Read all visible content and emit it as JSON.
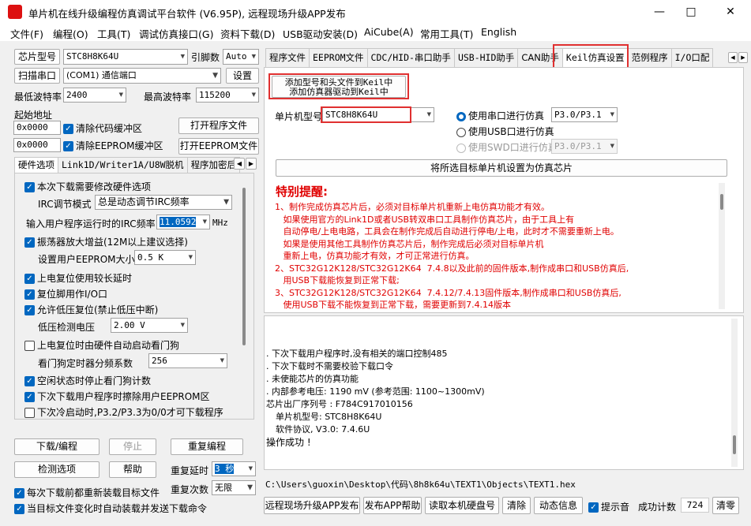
{
  "window": {
    "title": "单片机在线升级编程仿真调试平台软件 (V6.95P), 远程现场升级APP发布"
  },
  "menu": [
    "文件(F)",
    "编程(O)",
    "工具(T)",
    "调试仿真接口(G)",
    "资料下载(D)",
    "USB驱动安装(D)",
    "AiCube(A)",
    "常用工具(T)",
    "English"
  ],
  "left": {
    "chip_btn": "芯片型号",
    "chip_value": "STC8H8K64U",
    "pin_label": "引脚数",
    "pin_value": "Auto",
    "scan_btn": "扫描串口",
    "port_value": "(COM1) 通信端口",
    "settings_btn": "设置",
    "min_baud_label": "最低波特率",
    "min_baud": "2400",
    "max_baud_label": "最高波特率",
    "max_baud": "115200",
    "start_addr_label": "起始地址",
    "addr1": "0x0000",
    "clear_code": "清除代码缓冲区",
    "open_program": "打开程序文件",
    "addr2": "0x0000",
    "clear_eeprom": "清除EEPROM缓冲区",
    "open_eeprom": "打开EEPROM文件",
    "tabs": [
      "硬件选项",
      "Link1D/Writer1A/U8W脱机",
      "程序加密后"
    ]
  },
  "hw": {
    "opt1": "本次下载需要修改硬件选项",
    "irc_mode_label": "IRC调节模式",
    "irc_mode": "总是动态调节IRC频率",
    "irc_freq_label": "输入用户程序运行时的IRC频率",
    "irc_freq": "11.0592",
    "mhz": "MHz",
    "opt2": "振荡器放大增益(12M以上建议选择)",
    "eeprom_label": "设置用户EEPROM大小",
    "eeprom": "0.5 K",
    "opt3": "上电复位使用较长延时",
    "opt4": "复位脚用作I/O口",
    "opt5": "允许低压复位(禁止低压中断)",
    "lv_label": "低压检测电压",
    "lv": "2.00 V",
    "opt6": "上电复位时由硬件自动启动看门狗",
    "wdt_label": "看门狗定时器分频系数",
    "wdt": "256",
    "opt7": "空闲状态时停止看门狗计数",
    "opt8": "下次下载用户程序时擦除用户EEPROM区",
    "opt9": "下次冷启动时,P3.2/P3.3为0/0才可下载程序"
  },
  "bottom_left": {
    "download": "下载/编程",
    "stop": "停止",
    "reprogram": "重复编程",
    "detect": "检测选项",
    "help": "帮助",
    "delay_label": "重复延时",
    "delay": "3 秒",
    "count_label": "重复次数",
    "count": "无限",
    "chk1": "每次下载前都重新装载目标文件",
    "chk2": "当目标文件变化时自动装载并发送下载命令"
  },
  "right_tabs": [
    "程序文件",
    "EEPROM文件",
    "CDC/HID-串口助手",
    "USB-HID助手",
    "CAN助手",
    "Keil仿真设置",
    "范例程序",
    "I/O口配"
  ],
  "keil": {
    "add_btn_line1": "添加型号和头文件到Keil中",
    "add_btn_line2": "添加仿真器驱动到Keil中",
    "chip_label": "单片机型号",
    "chip": "STC8H8K64U",
    "r1": "使用串口进行仿真",
    "r1_val": "P3.0/P3.1",
    "r2": "使用USB口进行仿真",
    "r3": "使用SWD口进行仿真",
    "r3_val": "P3.0/P3.1",
    "set_btn": "将所选目标单片机设置为仿真芯片",
    "notice_title": "特别提醒:",
    "notice": [
      "1、制作完成仿真芯片后，必须对目标单片机重新上电仿真功能才有效。",
      "   如果使用官方的Link1D或者USB转双串口工具制作仿真芯片，由于工具上有",
      "   自动停电/上电电路，工具会在制作完成后自动进行停电/上电，此时才不需要重新上电。",
      "   如果是使用其他工具制作仿真芯片后，制作完成后必须对目标单片机",
      "   重新上电，仿真功能才有效，才可正常进行仿真。",
      "2、STC32G12K128/STC32G12K64  7.4.8以及此前的固件版本,制作成串口和USB仿真后,",
      "   用USB下载能恢复到正常下载;",
      "3、STC32G12K128/STC32G12K64  7.4.12/7.4.13固件版本,制作成串口和USB仿真后,",
      "   使用USB下载不能恢复到正常下载，需要更新到7.4.14版本"
    ]
  },
  "log": [
    ". 下次下载用户程序时,没有相关的端口控制485",
    ". 下次下载时不需要校验下载口令",
    ". 未使能芯片的仿真功能",
    ". 内部参考电压: 1190 mV (参考范围: 1100~1300mV)",
    "芯片出厂序列号 : F784C917010156",
    "",
    "单片机型号: STC8H8K64U",
    "软件协议, V3.0: 7.4.6U",
    "",
    "操作成功 !"
  ],
  "path": "C:\\Users\\guoxin\\Desktop\\代码\\8h8k64u\\TEXT1\\Objects\\TEXT1.hex",
  "bottom_right": {
    "publish": "远程现场升级APP发布",
    "publish_help": "发布APP帮助",
    "read_disk": "读取本机硬盘号",
    "clear": "清除",
    "anim": "动态信息",
    "beep": "提示音",
    "success_label": "成功计数",
    "success": "724",
    "reset": "清零"
  }
}
